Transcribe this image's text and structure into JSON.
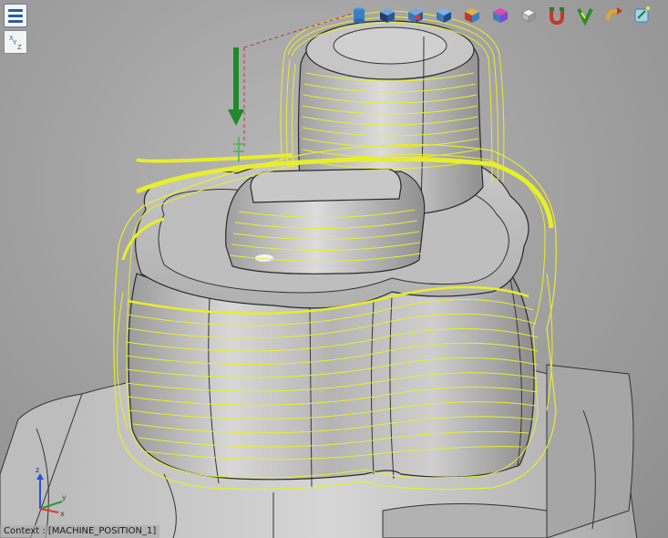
{
  "toolbar": {
    "items": [
      {
        "icon": "view-iso-icon",
        "label": ""
      },
      {
        "icon": "view-top-icon",
        "label": ""
      },
      {
        "icon": "view-front-icon",
        "label": ""
      },
      {
        "icon": "view-right-icon",
        "label": ""
      },
      {
        "icon": "view-shaded-icon",
        "label": ""
      },
      {
        "icon": "view-section-icon",
        "label": ""
      },
      {
        "icon": "render-mode-icon",
        "label": ""
      },
      {
        "icon": "magnet-icon",
        "label": ""
      },
      {
        "icon": "toolpath-filter-icon",
        "label": ""
      },
      {
        "icon": "simulation-icon",
        "label": ""
      },
      {
        "icon": "settings-toggle-icon",
        "label": ""
      }
    ]
  },
  "axes_widget": {
    "x": "X",
    "y": "Y",
    "z": "Z"
  },
  "triad": {
    "x": "x",
    "y": "y",
    "z": "z"
  },
  "status": {
    "text": "Context : [MACHINE_POSITION_1]"
  },
  "colors": {
    "toolpath": "#e8ee2a",
    "tool_arrow": "#1f8a2a",
    "model": "#c8c8c8",
    "background": "#a3a3a3"
  }
}
